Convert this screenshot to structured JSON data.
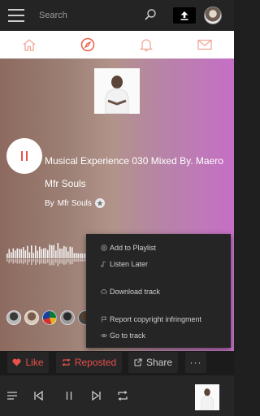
{
  "header": {
    "search_placeholder": "Search",
    "icons": [
      "menu-icon",
      "search-icon",
      "upload-icon",
      "avatar"
    ]
  },
  "nav": {
    "tabs": [
      {
        "name": "home",
        "icon": "home-icon",
        "active": false
      },
      {
        "name": "discover",
        "icon": "compass-icon",
        "active": true
      },
      {
        "name": "notifications",
        "icon": "bell-icon",
        "active": false
      },
      {
        "name": "messages",
        "icon": "mail-icon",
        "active": false
      }
    ]
  },
  "track": {
    "title": "Musical Experience 030 Mixed By. Maero Mfr Souls",
    "by_prefix": "By",
    "artist": "Mfr Souls",
    "state": "playing"
  },
  "menu": {
    "items": [
      {
        "label": "Add to Playlist",
        "icon": "add-playlist-icon"
      },
      {
        "label": "Listen Later",
        "icon": "listen-later-icon"
      },
      {
        "label": "Download track",
        "icon": "download-icon"
      },
      {
        "label": "Report copyright infringment",
        "icon": "flag-icon"
      },
      {
        "label": "Go to track",
        "icon": "eye-icon"
      }
    ]
  },
  "actions": {
    "like": "Like",
    "reposted": "Reposted",
    "share": "Share",
    "more": "···"
  },
  "colors": {
    "accent": "#e8504a",
    "nav_accent": "#f0826a",
    "topbar": "#242424",
    "player": "#262626"
  }
}
